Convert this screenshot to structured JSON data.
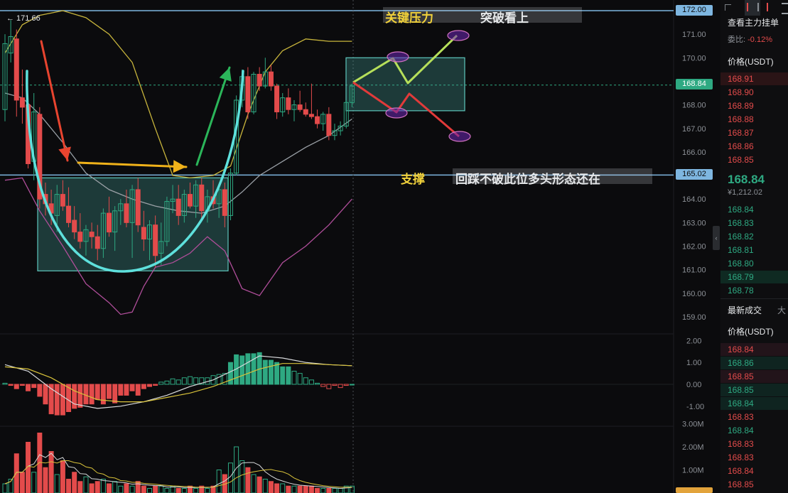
{
  "chart_data": {
    "type": "candlestick",
    "title": "",
    "y_axis_main": {
      "range": [
        158.0,
        172.5
      ],
      "ticks": [
        "172.00",
        "171.00",
        "170.00",
        "169.00",
        "168.00",
        "167.00",
        "166.00",
        "165.00",
        "164.00",
        "163.00",
        "162.00",
        "161.00",
        "160.00",
        "159.00"
      ]
    },
    "y_axis_macd": {
      "range": [
        -1.6,
        2.4
      ],
      "ticks": [
        "2.00",
        "1.00",
        "0.00",
        "-1.00"
      ]
    },
    "y_axis_volume": {
      "range": [
        0,
        3.4
      ],
      "unit": "M",
      "ticks": [
        "3.00M",
        "2.00M",
        "1.00M"
      ]
    },
    "candles": [
      {
        "o": 167.8,
        "h": 171.0,
        "l": 167.3,
        "c": 170.6
      },
      {
        "o": 170.2,
        "h": 171.6,
        "l": 169.8,
        "c": 170.9
      },
      {
        "o": 170.8,
        "h": 171.2,
        "l": 167.5,
        "c": 168.2
      },
      {
        "o": 168.3,
        "h": 169.5,
        "l": 167.2,
        "c": 167.9
      },
      {
        "o": 168.0,
        "h": 168.4,
        "l": 165.3,
        "c": 165.5
      },
      {
        "o": 165.6,
        "h": 168.5,
        "l": 164.8,
        "c": 167.7
      },
      {
        "o": 167.6,
        "h": 167.9,
        "l": 163.6,
        "c": 164.0
      },
      {
        "o": 164.2,
        "h": 164.7,
        "l": 163.3,
        "c": 163.8
      },
      {
        "o": 163.8,
        "h": 164.4,
        "l": 162.9,
        "c": 163.4
      },
      {
        "o": 163.3,
        "h": 164.6,
        "l": 162.6,
        "c": 164.2
      },
      {
        "o": 164.2,
        "h": 164.8,
        "l": 163.5,
        "c": 163.7
      },
      {
        "o": 163.7,
        "h": 164.5,
        "l": 162.8,
        "c": 163.0
      },
      {
        "o": 163.1,
        "h": 163.7,
        "l": 162.3,
        "c": 162.6
      },
      {
        "o": 162.6,
        "h": 163.4,
        "l": 161.9,
        "c": 162.2
      },
      {
        "o": 162.2,
        "h": 162.9,
        "l": 161.6,
        "c": 162.7
      },
      {
        "o": 162.6,
        "h": 163.0,
        "l": 161.9,
        "c": 162.4
      },
      {
        "o": 162.4,
        "h": 162.9,
        "l": 161.4,
        "c": 161.9
      },
      {
        "o": 161.9,
        "h": 163.6,
        "l": 161.5,
        "c": 163.4
      },
      {
        "o": 163.4,
        "h": 164.1,
        "l": 162.4,
        "c": 162.6
      },
      {
        "o": 162.6,
        "h": 163.7,
        "l": 161.8,
        "c": 163.5
      },
      {
        "o": 163.5,
        "h": 164.0,
        "l": 162.9,
        "c": 163.8
      },
      {
        "o": 163.8,
        "h": 164.4,
        "l": 162.8,
        "c": 163.0
      },
      {
        "o": 163.0,
        "h": 164.6,
        "l": 161.5,
        "c": 164.4
      },
      {
        "o": 164.4,
        "h": 164.9,
        "l": 162.6,
        "c": 162.9
      },
      {
        "o": 162.8,
        "h": 163.5,
        "l": 161.8,
        "c": 162.3
      },
      {
        "o": 162.3,
        "h": 163.1,
        "l": 161.4,
        "c": 162.9
      },
      {
        "o": 162.9,
        "h": 163.3,
        "l": 161.1,
        "c": 161.6
      },
      {
        "o": 161.7,
        "h": 163.0,
        "l": 161.2,
        "c": 162.2
      },
      {
        "o": 162.2,
        "h": 164.1,
        "l": 162.0,
        "c": 163.9
      },
      {
        "o": 163.9,
        "h": 164.6,
        "l": 163.4,
        "c": 164.0
      },
      {
        "o": 164.0,
        "h": 164.6,
        "l": 162.9,
        "c": 163.3
      },
      {
        "o": 163.3,
        "h": 164.4,
        "l": 163.0,
        "c": 164.2
      },
      {
        "o": 164.2,
        "h": 164.7,
        "l": 163.6,
        "c": 163.7
      },
      {
        "o": 163.7,
        "h": 164.8,
        "l": 163.2,
        "c": 164.6
      },
      {
        "o": 164.6,
        "h": 164.9,
        "l": 163.1,
        "c": 163.5
      },
      {
        "o": 163.5,
        "h": 164.4,
        "l": 163.0,
        "c": 164.1
      },
      {
        "o": 164.1,
        "h": 164.8,
        "l": 163.6,
        "c": 163.8
      },
      {
        "o": 163.8,
        "h": 164.6,
        "l": 163.2,
        "c": 164.4
      },
      {
        "o": 164.4,
        "h": 164.7,
        "l": 162.8,
        "c": 163.3
      },
      {
        "o": 163.3,
        "h": 165.3,
        "l": 163.1,
        "c": 165.1
      },
      {
        "o": 165.1,
        "h": 168.4,
        "l": 165.0,
        "c": 168.2
      },
      {
        "o": 168.2,
        "h": 169.5,
        "l": 167.9,
        "c": 169.2
      },
      {
        "o": 169.2,
        "h": 169.6,
        "l": 167.4,
        "c": 167.7
      },
      {
        "o": 167.7,
        "h": 169.4,
        "l": 167.6,
        "c": 169.3
      },
      {
        "o": 169.3,
        "h": 169.6,
        "l": 168.6,
        "c": 168.8
      },
      {
        "o": 168.8,
        "h": 170.0,
        "l": 168.7,
        "c": 169.4
      },
      {
        "o": 169.4,
        "h": 169.7,
        "l": 168.6,
        "c": 168.8
      },
      {
        "o": 168.8,
        "h": 168.9,
        "l": 167.4,
        "c": 167.7
      },
      {
        "o": 167.7,
        "h": 168.5,
        "l": 167.5,
        "c": 168.3
      },
      {
        "o": 168.3,
        "h": 168.7,
        "l": 167.6,
        "c": 167.8
      },
      {
        "o": 167.8,
        "h": 168.2,
        "l": 167.3,
        "c": 168.0
      },
      {
        "o": 168.0,
        "h": 168.6,
        "l": 167.7,
        "c": 167.8
      },
      {
        "o": 167.8,
        "h": 168.1,
        "l": 167.5,
        "c": 167.6
      },
      {
        "o": 167.6,
        "h": 168.9,
        "l": 167.4,
        "c": 167.5
      },
      {
        "o": 167.5,
        "h": 167.8,
        "l": 167.0,
        "c": 167.2
      },
      {
        "o": 167.2,
        "h": 167.7,
        "l": 166.9,
        "c": 167.6
      },
      {
        "o": 167.6,
        "h": 167.9,
        "l": 166.5,
        "c": 166.7
      },
      {
        "o": 166.7,
        "h": 167.2,
        "l": 166.5,
        "c": 166.9
      },
      {
        "o": 166.9,
        "h": 167.3,
        "l": 166.7,
        "c": 167.1
      },
      {
        "o": 167.1,
        "h": 168.2,
        "l": 167.0,
        "c": 168.1
      },
      {
        "o": 168.1,
        "h": 168.9,
        "l": 167.9,
        "c": 168.8
      }
    ],
    "bollinger": {
      "upper": [
        {
          "i": 0,
          "v": 170.2
        },
        {
          "i": 3,
          "v": 171.4
        },
        {
          "i": 6,
          "v": 171.8
        },
        {
          "i": 10,
          "v": 172.0
        },
        {
          "i": 14,
          "v": 171.7
        },
        {
          "i": 18,
          "v": 171.0
        },
        {
          "i": 22,
          "v": 169.8
        },
        {
          "i": 26,
          "v": 167.0
        },
        {
          "i": 29,
          "v": 165.0
        },
        {
          "i": 32,
          "v": 164.9
        },
        {
          "i": 36,
          "v": 165.0
        },
        {
          "i": 39,
          "v": 165.4
        },
        {
          "i": 42,
          "v": 167.6
        },
        {
          "i": 45,
          "v": 169.4
        },
        {
          "i": 48,
          "v": 170.3
        },
        {
          "i": 52,
          "v": 170.8
        },
        {
          "i": 56,
          "v": 170.7
        },
        {
          "i": 60,
          "v": 170.7
        }
      ],
      "middle": [
        {
          "i": 0,
          "v": 168.5
        },
        {
          "i": 3,
          "v": 168.3
        },
        {
          "i": 6,
          "v": 167.6
        },
        {
          "i": 10,
          "v": 166.4
        },
        {
          "i": 14,
          "v": 165.1
        },
        {
          "i": 18,
          "v": 164.4
        },
        {
          "i": 22,
          "v": 164.0
        },
        {
          "i": 26,
          "v": 163.7
        },
        {
          "i": 30,
          "v": 163.5
        },
        {
          "i": 34,
          "v": 163.4
        },
        {
          "i": 38,
          "v": 163.7
        },
        {
          "i": 41,
          "v": 164.3
        },
        {
          "i": 44,
          "v": 165.0
        },
        {
          "i": 48,
          "v": 165.6
        },
        {
          "i": 52,
          "v": 166.2
        },
        {
          "i": 56,
          "v": 166.7
        },
        {
          "i": 60,
          "v": 167.4
        }
      ],
      "lower": [
        {
          "i": 0,
          "v": 164.8
        },
        {
          "i": 3,
          "v": 164.9
        },
        {
          "i": 6,
          "v": 163.5
        },
        {
          "i": 10,
          "v": 162.0
        },
        {
          "i": 14,
          "v": 160.4
        },
        {
          "i": 18,
          "v": 159.6
        },
        {
          "i": 20,
          "v": 159.1
        },
        {
          "i": 22,
          "v": 159.2
        },
        {
          "i": 24,
          "v": 160.3
        },
        {
          "i": 26,
          "v": 161.1
        },
        {
          "i": 29,
          "v": 161.3
        },
        {
          "i": 32,
          "v": 161.7
        },
        {
          "i": 35,
          "v": 162.4
        },
        {
          "i": 38,
          "v": 161.8
        },
        {
          "i": 41,
          "v": 160.2
        },
        {
          "i": 44,
          "v": 159.9
        },
        {
          "i": 48,
          "v": 161.3
        },
        {
          "i": 52,
          "v": 162.0
        },
        {
          "i": 56,
          "v": 162.9
        },
        {
          "i": 60,
          "v": 164.0
        }
      ]
    },
    "macd_hist": [
      0.05,
      -0.05,
      -0.2,
      -0.05,
      -0.3,
      -0.15,
      -0.55,
      -0.9,
      -1.35,
      -1.4,
      -1.4,
      -1.25,
      -1.1,
      -1.05,
      -0.9,
      -0.9,
      -0.7,
      -0.9,
      -0.65,
      -0.85,
      -0.5,
      -0.5,
      -0.3,
      -0.5,
      -0.2,
      -0.1,
      -0.05,
      0.1,
      0.15,
      0.25,
      0.2,
      0.3,
      0.35,
      0.3,
      0.3,
      0.3,
      0.4,
      0.45,
      0.5,
      1.0,
      1.35,
      1.3,
      1.4,
      1.4,
      1.45,
      1.1,
      1.1,
      1.0,
      0.8,
      0.8,
      0.6,
      0.5,
      0.3,
      0.2,
      0.05,
      -0.1,
      -0.2,
      -0.05,
      -0.15,
      -0.05,
      0.0
    ],
    "macd_dif": [
      {
        "i": 0,
        "v": 0.9
      },
      {
        "i": 4,
        "v": 0.6
      },
      {
        "i": 8,
        "v": -0.2
      },
      {
        "i": 12,
        "v": -0.9
      },
      {
        "i": 16,
        "v": -1.1
      },
      {
        "i": 20,
        "v": -1.0
      },
      {
        "i": 24,
        "v": -0.8
      },
      {
        "i": 28,
        "v": -0.5
      },
      {
        "i": 32,
        "v": -0.1
      },
      {
        "i": 36,
        "v": 0.2
      },
      {
        "i": 40,
        "v": 0.7
      },
      {
        "i": 44,
        "v": 1.3
      },
      {
        "i": 48,
        "v": 1.2
      },
      {
        "i": 52,
        "v": 1.0
      },
      {
        "i": 56,
        "v": 0.9
      },
      {
        "i": 60,
        "v": 0.85
      }
    ],
    "macd_dea": [
      {
        "i": 0,
        "v": 0.8
      },
      {
        "i": 4,
        "v": 0.7
      },
      {
        "i": 8,
        "v": 0.3
      },
      {
        "i": 12,
        "v": -0.3
      },
      {
        "i": 16,
        "v": -0.7
      },
      {
        "i": 20,
        "v": -0.8
      },
      {
        "i": 24,
        "v": -0.8
      },
      {
        "i": 28,
        "v": -0.6
      },
      {
        "i": 32,
        "v": -0.4
      },
      {
        "i": 36,
        "v": -0.1
      },
      {
        "i": 40,
        "v": 0.3
      },
      {
        "i": 44,
        "v": 0.7
      },
      {
        "i": 48,
        "v": 0.95
      },
      {
        "i": 52,
        "v": 0.95
      },
      {
        "i": 56,
        "v": 0.9
      },
      {
        "i": 60,
        "v": 0.85
      }
    ],
    "volume": [
      0.4,
      0.6,
      1.7,
      0.9,
      2.2,
      0.9,
      2.6,
      1.1,
      1.8,
      0.8,
      1.4,
      0.6,
      0.9,
      0.5,
      0.7,
      0.4,
      0.5,
      0.6,
      0.4,
      0.5,
      0.3,
      0.4,
      0.3,
      0.5,
      0.3,
      0.2,
      0.3,
      0.3,
      0.2,
      0.3,
      0.2,
      0.2,
      0.3,
      0.2,
      0.3,
      0.2,
      0.3,
      1.0,
      0.8,
      1.3,
      2.0,
      1.4,
      1.1,
      0.8,
      0.7,
      0.6,
      0.5,
      0.4,
      0.4,
      0.3,
      0.3,
      0.3,
      0.3,
      0.3,
      0.2,
      0.2,
      0.2,
      0.2,
      0.2,
      0.3,
      0.3
    ],
    "levels": [
      {
        "price": 172.0,
        "label": "172.00"
      },
      {
        "price": 165.02,
        "label": "165.02"
      }
    ],
    "last_price": {
      "price": 168.84,
      "label": "168.84"
    },
    "high_marker": "171.66",
    "annotations": {
      "resistance": "关键压力",
      "breakout": "突破看上",
      "support": "支撑",
      "support_note": "回踩不破此位多头形态还在"
    },
    "grid": false,
    "colors": {
      "up": "#2ea982",
      "down": "#e34b4b",
      "level": "#7eb6e0",
      "band_upper": "#c8b53c",
      "band_middle": "#9aa0a6",
      "band_lower": "#b04e9a",
      "cup": "#5ee0dc",
      "volume_bottom_tag": "#e2a33b"
    }
  },
  "orderbook": {
    "header_title": "查看主力挂单",
    "ratio_label": "委比:",
    "ratio_value": "-0.12%",
    "price_header": "价格(USDT)",
    "asks": [
      "168.91",
      "168.90",
      "168.89",
      "168.88",
      "168.87",
      "168.86",
      "168.85"
    ],
    "last_price": "168.84",
    "last_price_cny": "¥1,212.02",
    "bids": [
      "168.84",
      "168.83",
      "168.82",
      "168.81",
      "168.80",
      "168.79",
      "168.78"
    ],
    "trades_tab": "最新成交",
    "trades_tab_2": "大",
    "trades_price_header": "价格(USDT)",
    "trades": [
      {
        "p": "168.84",
        "side": "down"
      },
      {
        "p": "168.86",
        "side": "up"
      },
      {
        "p": "168.85",
        "side": "down"
      },
      {
        "p": "168.85",
        "side": "up"
      },
      {
        "p": "168.84",
        "side": "up"
      },
      {
        "p": "168.83",
        "side": "down"
      },
      {
        "p": "168.84",
        "side": "up"
      },
      {
        "p": "168.83",
        "side": "down"
      },
      {
        "p": "168.83",
        "side": "down"
      },
      {
        "p": "168.84",
        "side": "down"
      },
      {
        "p": "168.85",
        "side": "down"
      }
    ]
  }
}
